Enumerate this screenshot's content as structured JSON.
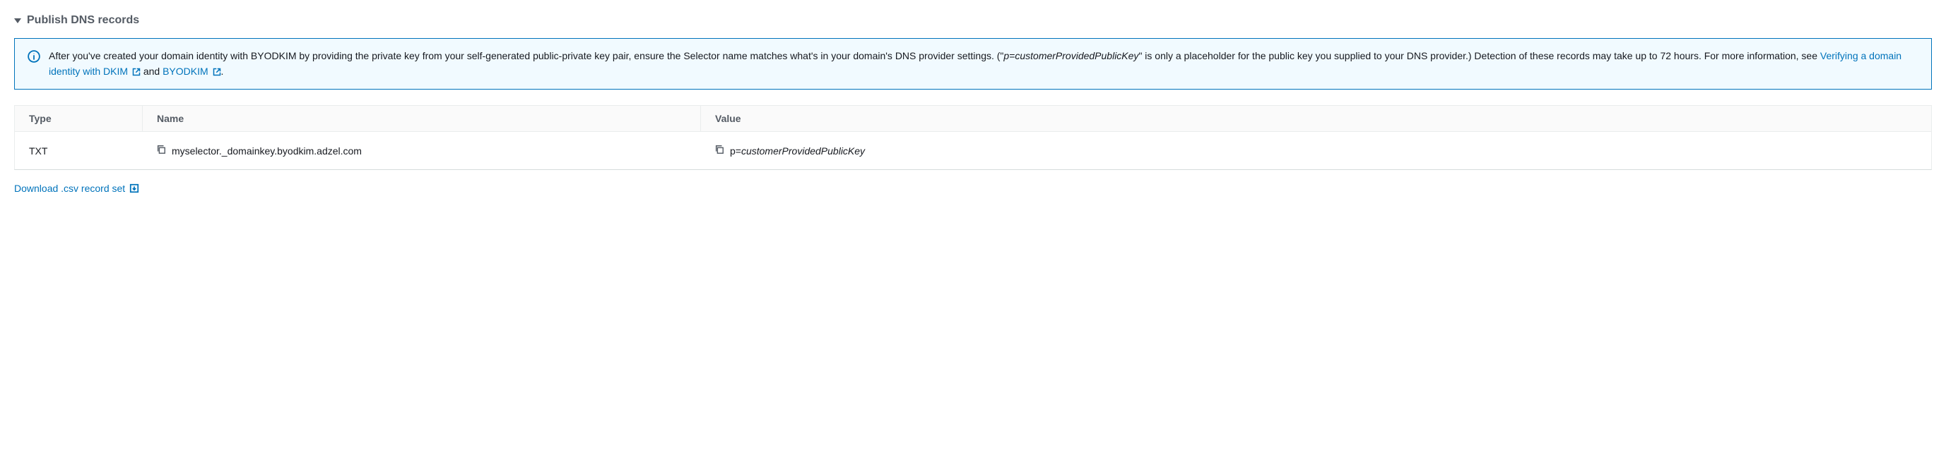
{
  "section": {
    "title": "Publish DNS records"
  },
  "info": {
    "text_before_italic": "After you've created your domain identity with BYODKIM by providing the private key from your self-generated public-private key pair, ensure the Selector name matches what's in your domain's DNS provider settings. (\"",
    "italic_part": "p=customerProvidedPublicKey",
    "text_after_italic": "\" is only a placeholder for the public key you supplied to your DNS provider.) Detection of these records may take up to 72 hours. For more information, see ",
    "link1_label": "Verifying a domain identity with DKIM",
    "between_links": " and ",
    "link2_label": "BYODKIM",
    "trailing": "."
  },
  "table": {
    "headers": {
      "type": "Type",
      "name": "Name",
      "value": "Value"
    },
    "row": {
      "type": "TXT",
      "name": "myselector._domainkey.byodkim.adzel.com",
      "value_prefix": "p=",
      "value_italic": "customerProvidedPublicKey"
    }
  },
  "download": {
    "label": "Download .csv record set"
  }
}
